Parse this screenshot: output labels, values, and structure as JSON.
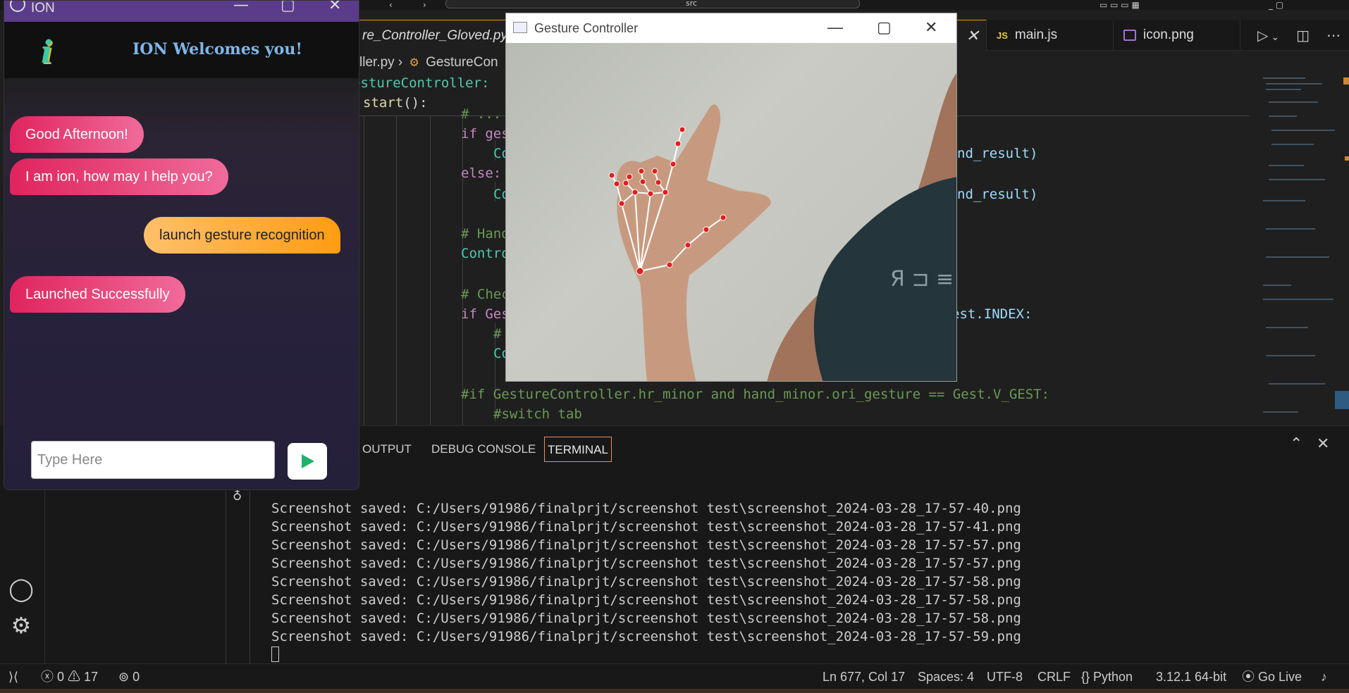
{
  "vscode": {
    "tabs": [
      {
        "label": "re_Controller_Gloved.py",
        "active": true
      },
      {
        "label": "main.js",
        "icon": "JS"
      },
      {
        "label": "icon.png",
        "icon": "image-icon"
      }
    ],
    "breadcrumb": {
      "file": "ller.py",
      "symbol": "GestureCon"
    },
    "code": {
      "line1": "estureController:",
      "line2a": "start",
      "line2b": "():",
      "line3": "# ...",
      "line4": "if ges",
      "line5": "Co",
      "line5r": "nd_result)",
      "line6": "else:",
      "line7": "Co",
      "line7r": "nd_result)",
      "line8": "# Hand",
      "line9": "Contro",
      "line10": "# Chec",
      "line11": "if Ges",
      "line11r": "est.INDEX:",
      "line12": "#",
      "line13": "Co",
      "line14": "#if GestureController.hr_minor and hand_minor.ori_gesture == Gest.V_GEST:",
      "line15": "#switch tab"
    },
    "panel_tabs": [
      "OUTPUT",
      "DEBUG CONSOLE",
      "TERMINAL"
    ],
    "terminal_lines": [
      "Screenshot saved: C:/Users/91986/finalprjt/screenshot test\\screenshot_2024-03-28_17-57-40.png",
      "Screenshot saved: C:/Users/91986/finalprjt/screenshot test\\screenshot_2024-03-28_17-57-41.png",
      "Screenshot saved: C:/Users/91986/finalprjt/screenshot test\\screenshot_2024-03-28_17-57-57.png",
      "Screenshot saved: C:/Users/91986/finalprjt/screenshot test\\screenshot_2024-03-28_17-57-57.png",
      "Screenshot saved: C:/Users/91986/finalprjt/screenshot test\\screenshot_2024-03-28_17-57-58.png",
      "Screenshot saved: C:/Users/91986/finalprjt/screenshot test\\screenshot_2024-03-28_17-57-58.png",
      "Screenshot saved: C:/Users/91986/finalprjt/screenshot test\\screenshot_2024-03-28_17-57-58.png",
      "Screenshot saved: C:/Users/91986/finalprjt/screenshot test\\screenshot_2024-03-28_17-57-59.png"
    ],
    "status": {
      "errors": "0",
      "warnings": "17",
      "ports": "0",
      "position": "Ln 677, Col 17",
      "spaces": "Spaces: 4",
      "encoding": "UTF-8",
      "eol": "CRLF",
      "language": "Python",
      "interpreter": "3.12.1 64-bit",
      "live": "Go Live"
    }
  },
  "ion": {
    "title": "ION",
    "logo": "i",
    "welcome": "ION Welcomes you!",
    "messages": [
      {
        "from": "bot",
        "text": "Good Afternoon!"
      },
      {
        "from": "bot",
        "text": "I am ion, how may I help you?"
      },
      {
        "from": "user",
        "text": "launch gesture recognition"
      },
      {
        "from": "bot",
        "text": "Launched Successfully"
      }
    ],
    "input_placeholder": "Type Here"
  },
  "gesture": {
    "title": "Gesture Controller",
    "shirt_text": "Я ⊐ ≡"
  }
}
